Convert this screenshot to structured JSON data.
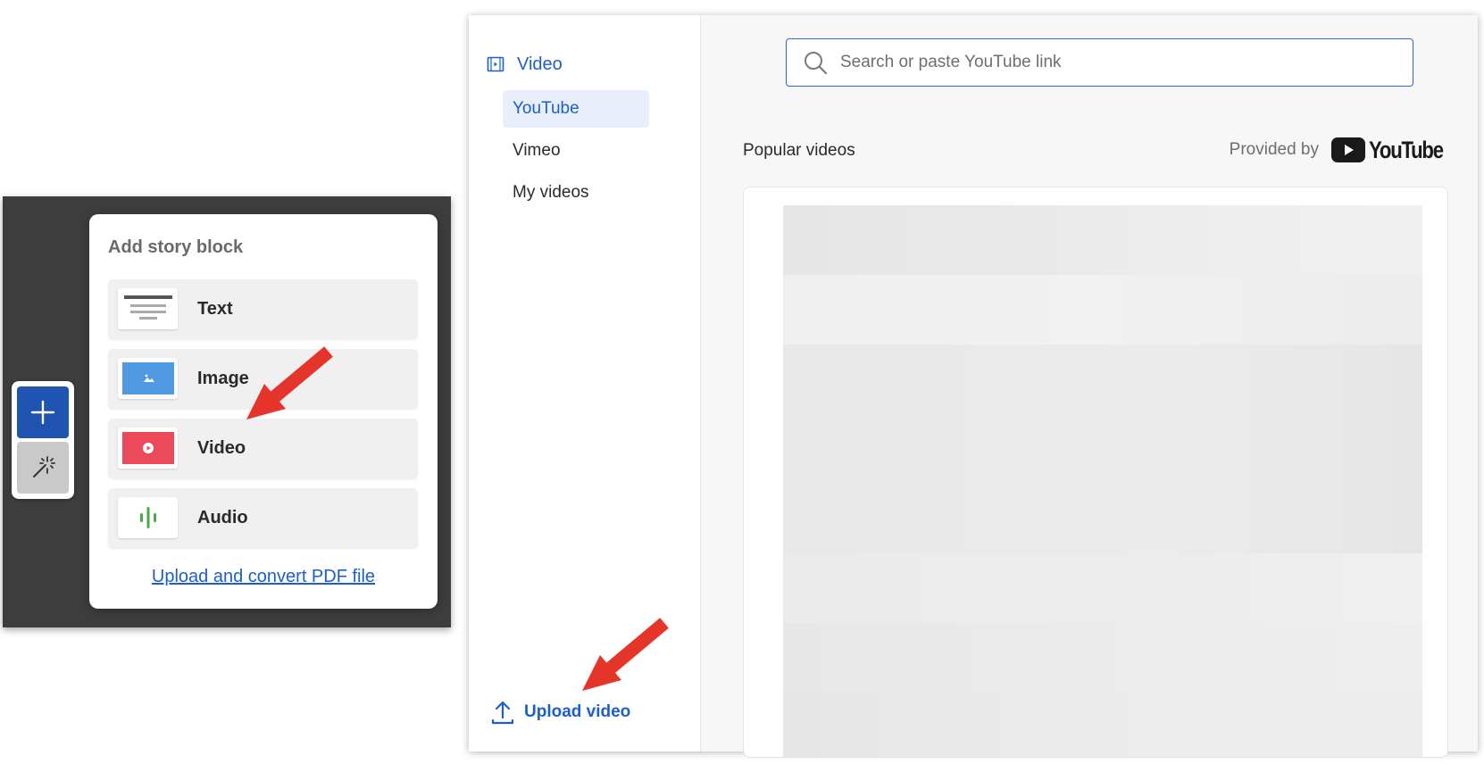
{
  "story_block_menu": {
    "title": "Add story block",
    "options": [
      {
        "label": "Text",
        "icon": "text-lines-icon"
      },
      {
        "label": "Image",
        "icon": "image-icon"
      },
      {
        "label": "Video",
        "icon": "video-play-icon"
      },
      {
        "label": "Audio",
        "icon": "audio-waveform-icon"
      }
    ],
    "pdf_link": "Upload and convert PDF file"
  },
  "side_tools": {
    "add_icon": "plus-icon",
    "magic_icon": "magic-wand-icon"
  },
  "video_panel": {
    "heading": "Video",
    "heading_icon": "film-icon",
    "nav_items": [
      {
        "label": "YouTube",
        "active": true
      },
      {
        "label": "Vimeo",
        "active": false
      },
      {
        "label": "My videos",
        "active": false
      }
    ],
    "upload_label": "Upload video",
    "upload_icon": "upload-arrow-icon",
    "search": {
      "placeholder": "Search or paste YouTube link",
      "value": ""
    },
    "popular_title": "Popular videos",
    "provided_by_label": "Provided by",
    "provider_name": "YouTube"
  },
  "colors": {
    "accent_blue": "#1d5fc9",
    "dark_blue_button": "#1f54b2",
    "annotation_red": "#e5352b",
    "video_thumb_red": "#ea4a5a",
    "image_thumb_blue": "#4f9ae0",
    "audio_green": "#48a84a"
  }
}
